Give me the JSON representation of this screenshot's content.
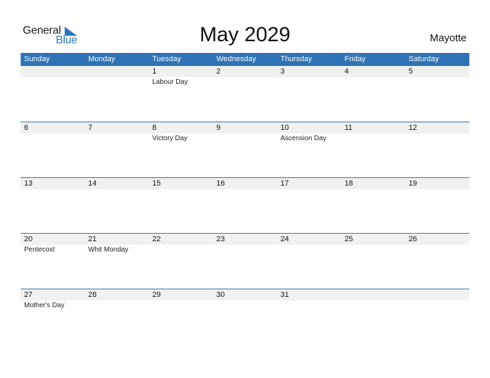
{
  "logo": {
    "word1": "General",
    "word2": "Blue"
  },
  "title": "May 2029",
  "country": "Mayotte",
  "colors": {
    "header_bg": "#2e73b5",
    "band_bg": "#f1f1f1",
    "brand_blue": "#2a75bb"
  },
  "weekdays": [
    "Sunday",
    "Monday",
    "Tuesday",
    "Wednesday",
    "Thursday",
    "Friday",
    "Saturday"
  ],
  "weeks": [
    [
      {
        "day": "",
        "holiday": ""
      },
      {
        "day": "",
        "holiday": ""
      },
      {
        "day": "1",
        "holiday": "Labour Day"
      },
      {
        "day": "2",
        "holiday": ""
      },
      {
        "day": "3",
        "holiday": ""
      },
      {
        "day": "4",
        "holiday": ""
      },
      {
        "day": "5",
        "holiday": ""
      }
    ],
    [
      {
        "day": "6",
        "holiday": ""
      },
      {
        "day": "7",
        "holiday": ""
      },
      {
        "day": "8",
        "holiday": "Victory Day"
      },
      {
        "day": "9",
        "holiday": ""
      },
      {
        "day": "10",
        "holiday": "Ascension Day"
      },
      {
        "day": "11",
        "holiday": ""
      },
      {
        "day": "12",
        "holiday": ""
      }
    ],
    [
      {
        "day": "13",
        "holiday": ""
      },
      {
        "day": "14",
        "holiday": ""
      },
      {
        "day": "15",
        "holiday": ""
      },
      {
        "day": "16",
        "holiday": ""
      },
      {
        "day": "17",
        "holiday": ""
      },
      {
        "day": "18",
        "holiday": ""
      },
      {
        "day": "19",
        "holiday": ""
      }
    ],
    [
      {
        "day": "20",
        "holiday": "Pentecost"
      },
      {
        "day": "21",
        "holiday": "Whit Monday"
      },
      {
        "day": "22",
        "holiday": ""
      },
      {
        "day": "23",
        "holiday": ""
      },
      {
        "day": "24",
        "holiday": ""
      },
      {
        "day": "25",
        "holiday": ""
      },
      {
        "day": "26",
        "holiday": ""
      }
    ],
    [
      {
        "day": "27",
        "holiday": "Mother's Day"
      },
      {
        "day": "28",
        "holiday": ""
      },
      {
        "day": "29",
        "holiday": ""
      },
      {
        "day": "30",
        "holiday": ""
      },
      {
        "day": "31",
        "holiday": ""
      },
      {
        "day": "",
        "holiday": ""
      },
      {
        "day": "",
        "holiday": ""
      }
    ]
  ]
}
